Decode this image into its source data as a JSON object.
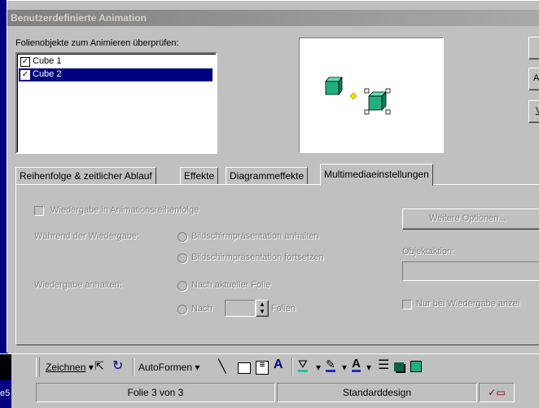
{
  "dialog": {
    "title": "Benutzerdefinierte Animation",
    "objects_label": "Folienobjekte zum Animieren überprüfen:",
    "objects": [
      {
        "label": "Cube 1",
        "checked": true,
        "selected": false
      },
      {
        "label": "Cube 2",
        "checked": true,
        "selected": true
      }
    ],
    "right_buttons": [
      "",
      "A",
      "V"
    ]
  },
  "tabs": [
    {
      "label": "Reihenfolge & zeitlicher Ablauf",
      "active": false
    },
    {
      "label": "Effekte",
      "active": false
    },
    {
      "label": "Diagrammeffekte",
      "active": false
    },
    {
      "label": "Multimediaeinstellungen",
      "active": true
    }
  ],
  "multimedia": {
    "play_in_order": "Wiedergabe in Animationsreihenfolge",
    "during_playback": "Während der Wiedergabe:",
    "pause_presentation": "Bildschirmpräsentation anhalten",
    "continue_presentation": "Bildschirmpräsentation fortsetzen",
    "stop_playback": "Wiedergabe anhalten:",
    "after_current_slide": "Nach aktueller Folie",
    "after": "Nach",
    "slides": "Folien",
    "more_options": "Weitere Optionen...",
    "object_action": "Objektaktion:",
    "only_when_playing": "Nur bei Wiedergabe anzei"
  },
  "toolbar": {
    "draw": "Zeichnen",
    "autoshapes": "AutoFormen"
  },
  "statusbar": {
    "left": "e5",
    "slide": "Folie 3 von 3",
    "design": "Standarddesign"
  },
  "colors": {
    "title_gradient_start": "#808080",
    "selection": "#000080",
    "cube": "#20b080"
  }
}
